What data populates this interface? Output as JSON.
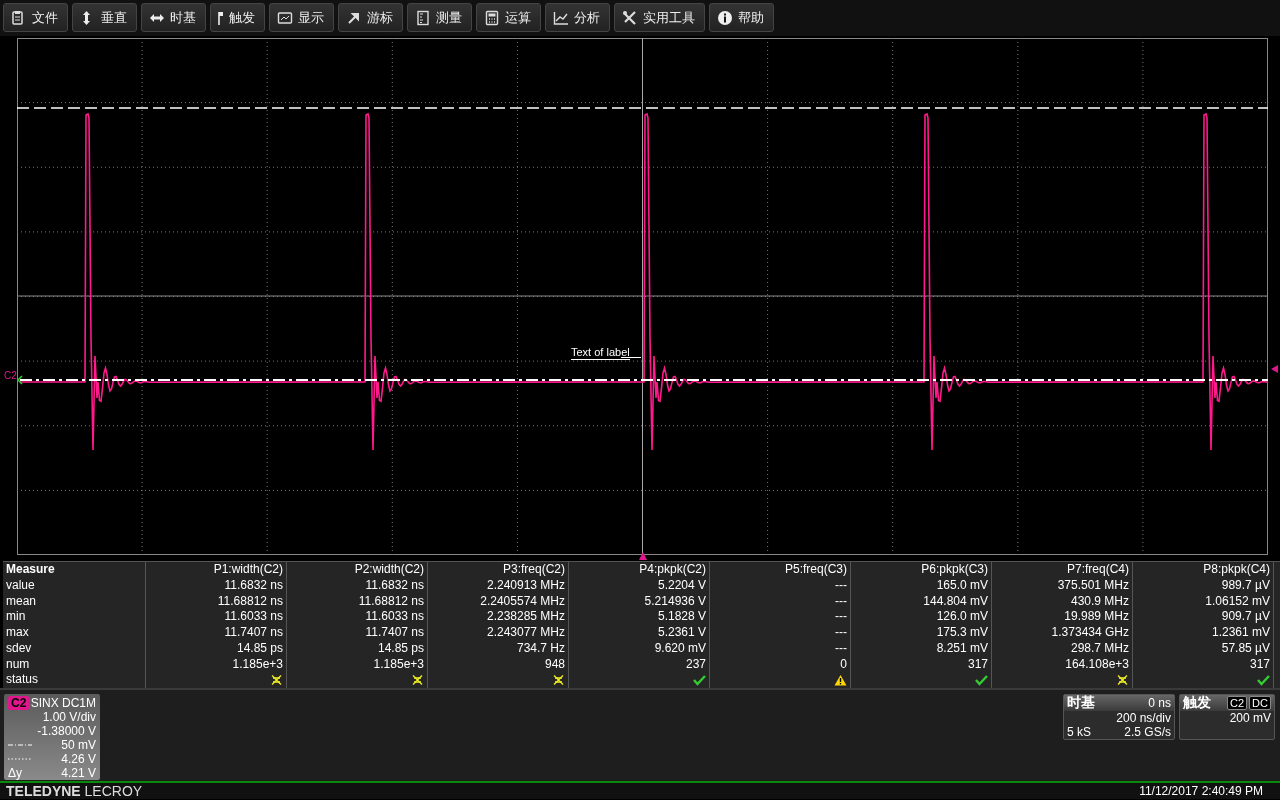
{
  "menu": [
    {
      "label": "文件"
    },
    {
      "label": "垂直"
    },
    {
      "label": "时基"
    },
    {
      "label": "触发"
    },
    {
      "label": "显示"
    },
    {
      "label": "游标"
    },
    {
      "label": "测量"
    },
    {
      "label": "运算"
    },
    {
      "label": "分析"
    },
    {
      "label": "实用工具"
    },
    {
      "label": "帮助"
    }
  ],
  "display": {
    "trace_label": "C2",
    "annotation": "Text of label"
  },
  "measure": {
    "title": "Measure",
    "columns": [
      "P1:width(C2)",
      "P2:width(C2)",
      "P3:freq(C2)",
      "P4:pkpk(C2)",
      "P5:freq(C3)",
      "P6:pkpk(C3)",
      "P7:freq(C4)",
      "P8:pkpk(C4)"
    ],
    "rows": [
      {
        "label": "value",
        "cells": [
          "11.6832 ns",
          "11.6832 ns",
          "2.240913 MHz",
          "5.2204 V",
          "---",
          "165.0 mV",
          "375.501 MHz",
          "989.7 µV"
        ]
      },
      {
        "label": "mean",
        "cells": [
          "11.68812 ns",
          "11.68812 ns",
          "2.2405574 MHz",
          "5.214936 V",
          "---",
          "144.804 mV",
          "430.9 MHz",
          "1.06152 mV"
        ]
      },
      {
        "label": "min",
        "cells": [
          "11.6033 ns",
          "11.6033 ns",
          "2.238285 MHz",
          "5.1828 V",
          "---",
          "126.0 mV",
          "19.989 MHz",
          "909.7 µV"
        ]
      },
      {
        "label": "max",
        "cells": [
          "11.7407 ns",
          "11.7407 ns",
          "2.243077 MHz",
          "5.2361 V",
          "---",
          "175.3 mV",
          "1.373434 GHz",
          "1.2361 mV"
        ]
      },
      {
        "label": "sdev",
        "cells": [
          "14.85 ps",
          "14.85 ps",
          "734.7 Hz",
          "9.620 mV",
          "---",
          "8.251 mV",
          "298.7 MHz",
          "57.85 µV"
        ]
      },
      {
        "label": "num",
        "cells": [
          "1.185e+3",
          "1.185e+3",
          "948",
          "237",
          "0",
          "317",
          "164.108e+3",
          "317"
        ]
      }
    ],
    "status": {
      "label": "status",
      "cells": [
        {
          "kind": "uncertain"
        },
        {
          "kind": "uncertain"
        },
        {
          "kind": "uncertain"
        },
        {
          "kind": "ok"
        },
        {
          "kind": "warning"
        },
        {
          "kind": "ok"
        },
        {
          "kind": "uncertain"
        },
        {
          "kind": "ok"
        }
      ]
    }
  },
  "channel": {
    "name": "C2",
    "coupling": "SINX DC1M",
    "scale": "1.00 V/div",
    "offset": "-1.38000 V",
    "rows": [
      {
        "kind": "dashdot",
        "value": "50 mV"
      },
      {
        "kind": "dotted",
        "value": "4.26 V"
      },
      {
        "kind": "text",
        "label": "Δy",
        "value": "4.21 V"
      }
    ]
  },
  "timebase": {
    "title": "时基",
    "delay": "0 ns",
    "scale": "200 ns/div",
    "samples": "5 kS",
    "rate": "2.5 GS/s"
  },
  "trigger": {
    "title": "触发",
    "source": "C2",
    "coupling": "DC",
    "threshold": "200 mV"
  },
  "footer": {
    "brand_bold": "TELEDYNE",
    "brand": "LECROY",
    "datetime": "11/12/2017 2:40:49 PM"
  }
}
